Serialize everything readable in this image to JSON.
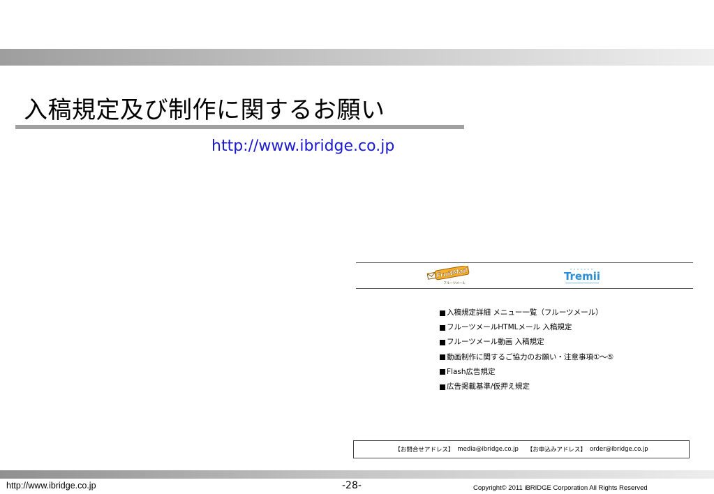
{
  "slide": {
    "title": "入稿規定及び制作に関するお願い",
    "url": "http://www.ibridge.co.jp"
  },
  "logos": {
    "fruitmail": {
      "text": "FruitMail",
      "subtext": "フルーツメール",
      "icon": "fruitmail-logo"
    },
    "tremii": {
      "text": "Tremii",
      "icon": "tremii-logo"
    }
  },
  "menu": {
    "items": [
      "入稿規定詳細 メニュー一覧（フルーツメール）",
      "フルーツメールHTMLメール 入稿規定",
      "フルーツメール動画 入稿規定",
      "動画制作に関するご協力のお願い・注意事項①～⑤",
      "Flash広告規定",
      "広告掲載基準/仮押え規定"
    ]
  },
  "contact": {
    "inquiry_label": "【お問合せアドレス】",
    "inquiry_email": "media@ibridge.co.jp",
    "order_label": "【お申込みアドレス】",
    "order_email": "order@ibridge.co.jp"
  },
  "footer": {
    "url": "http://www.ibridge.co.jp",
    "page": "-28-",
    "copyright": "Copyright© 2011 iBRIDGE Corporation All Rights Reserved"
  },
  "colors": {
    "link": "#1a1acc",
    "band_dark": "#9e9e9e",
    "band_light": "#efefef",
    "fruitmail_orange": "#f29a1f",
    "tremii_blue": "#2a8fd6"
  }
}
